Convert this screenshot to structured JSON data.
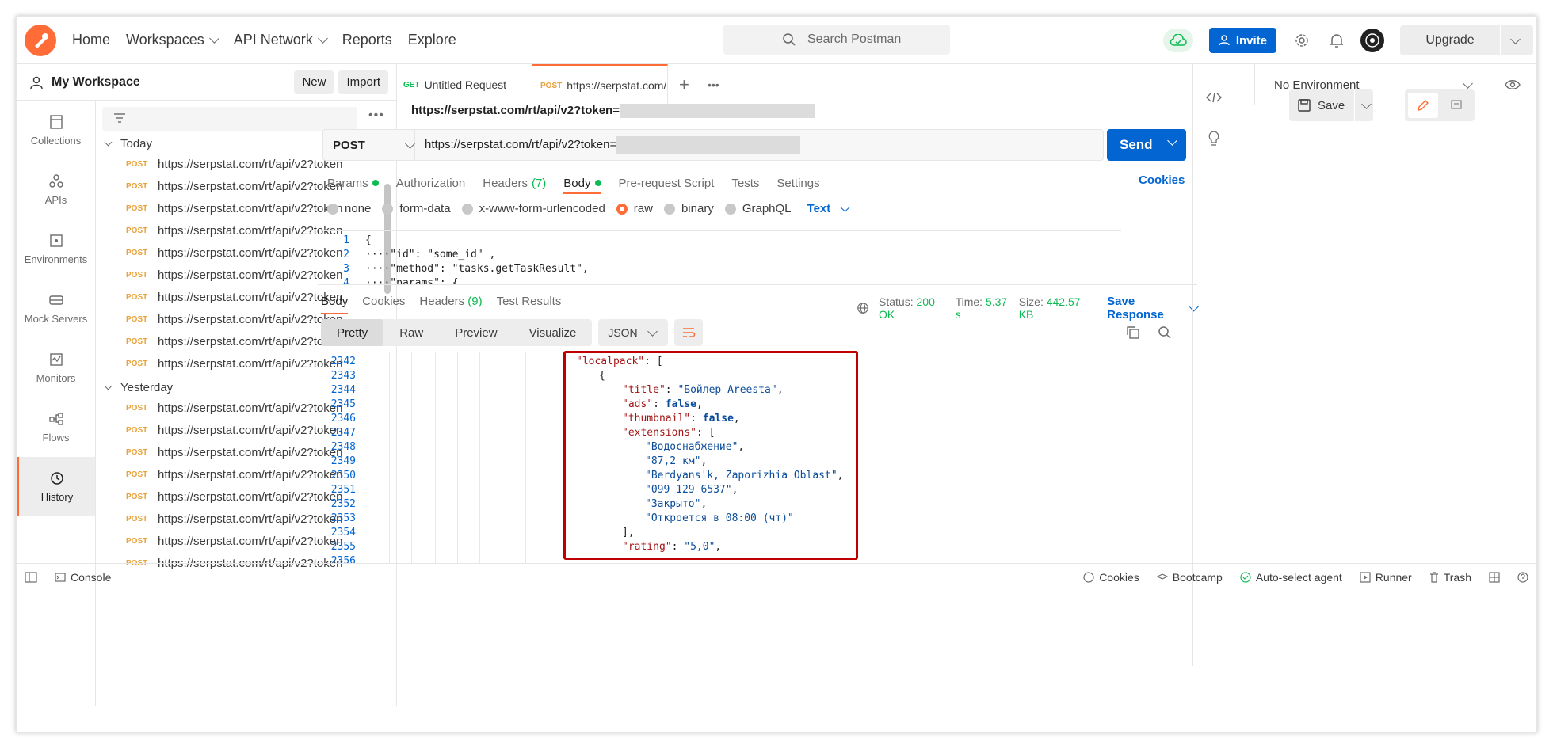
{
  "header": {
    "nav": [
      {
        "label": "Home"
      },
      {
        "label": "Workspaces",
        "dropdown": true
      },
      {
        "label": "API Network",
        "dropdown": true
      },
      {
        "label": "Reports"
      },
      {
        "label": "Explore"
      }
    ],
    "search_placeholder": "Search Postman",
    "invite_label": "Invite",
    "upgrade_label": "Upgrade",
    "accent": "#ff6c37",
    "primary": "#0265d2"
  },
  "workspace": {
    "title": "My Workspace",
    "new_label": "New",
    "import_label": "Import"
  },
  "rail": [
    {
      "label": "Collections",
      "icon": "collections-icon"
    },
    {
      "label": "APIs",
      "icon": "apis-icon"
    },
    {
      "label": "Environments",
      "icon": "environments-icon"
    },
    {
      "label": "Mock Servers",
      "icon": "mock-servers-icon"
    },
    {
      "label": "Monitors",
      "icon": "monitors-icon"
    },
    {
      "label": "Flows",
      "icon": "flows-icon"
    },
    {
      "label": "History",
      "icon": "history-icon",
      "active": true
    }
  ],
  "history": {
    "groups": [
      {
        "label": "Today",
        "items": [
          {
            "method": "POST",
            "url": "https://serpstat.com/rt/api/v2?token"
          },
          {
            "method": "POST",
            "url": "https://serpstat.com/rt/api/v2?token"
          },
          {
            "method": "POST",
            "url": "https://serpstat.com/rt/api/v2?token"
          },
          {
            "method": "POST",
            "url": "https://serpstat.com/rt/api/v2?token"
          },
          {
            "method": "POST",
            "url": "https://serpstat.com/rt/api/v2?token"
          },
          {
            "method": "POST",
            "url": "https://serpstat.com/rt/api/v2?token"
          },
          {
            "method": "POST",
            "url": "https://serpstat.com/rt/api/v2?token"
          },
          {
            "method": "POST",
            "url": "https://serpstat.com/rt/api/v2?token"
          },
          {
            "method": "POST",
            "url": "https://serpstat.com/rt/api/v2?token"
          },
          {
            "method": "POST",
            "url": "https://serpstat.com/rt/api/v2?token"
          }
        ]
      },
      {
        "label": "Yesterday",
        "items": [
          {
            "method": "POST",
            "url": "https://serpstat.com/rt/api/v2?token"
          },
          {
            "method": "POST",
            "url": "https://serpstat.com/rt/api/v2?token"
          },
          {
            "method": "POST",
            "url": "https://serpstat.com/rt/api/v2?token"
          },
          {
            "method": "POST",
            "url": "https://serpstat.com/rt/api/v2?token"
          },
          {
            "method": "POST",
            "url": "https://serpstat.com/rt/api/v2?token"
          },
          {
            "method": "POST",
            "url": "https://serpstat.com/rt/api/v2?token"
          },
          {
            "method": "POST",
            "url": "https://serpstat.com/rt/api/v2?token"
          },
          {
            "method": "POST",
            "url": "https://serpstat.com/rt/api/v2?token"
          }
        ]
      }
    ]
  },
  "tabs": [
    {
      "method": "GET",
      "label": "Untitled Request",
      "method_color": "#0cbb52"
    },
    {
      "method": "POST",
      "label": "https://serpstat.com/rt/a",
      "method_color": "#e8a23c",
      "active": true
    }
  ],
  "environment": "No Environment",
  "request": {
    "title": "https://serpstat.com/rt/api/v2?token=",
    "save_label": "Save",
    "method": "POST",
    "url": "https://serpstat.com/rt/api/v2?token=",
    "send_label": "Send",
    "tabs": [
      {
        "label": "Params",
        "dot": true
      },
      {
        "label": "Authorization"
      },
      {
        "label": "Headers",
        "count": "(7)"
      },
      {
        "label": "Body",
        "dot": true,
        "active": true
      },
      {
        "label": "Pre-request Script"
      },
      {
        "label": "Tests"
      },
      {
        "label": "Settings"
      }
    ],
    "cookies_label": "Cookies",
    "body_types": [
      {
        "label": "none"
      },
      {
        "label": "form-data"
      },
      {
        "label": "x-www-form-urlencoded"
      },
      {
        "label": "raw",
        "selected": true
      },
      {
        "label": "binary"
      },
      {
        "label": "GraphQL"
      }
    ],
    "body_format": "Text",
    "body_lines": [
      {
        "n": "1",
        "text": "{"
      },
      {
        "n": "2",
        "text": "····\"id\": \"some_id\" ,"
      },
      {
        "n": "3",
        "text": "····\"method\": \"tasks.getTaskResult\","
      },
      {
        "n": "4",
        "text": "····\"params\": {"
      }
    ]
  },
  "response": {
    "tabs": [
      {
        "label": "Body",
        "active": true
      },
      {
        "label": "Cookies"
      },
      {
        "label": "Headers",
        "count": "(9)"
      },
      {
        "label": "Test Results"
      }
    ],
    "status_label": "Status:",
    "status_value": "200 OK",
    "time_label": "Time:",
    "time_value": "5.37 s",
    "size_label": "Size:",
    "size_value": "442.57 KB",
    "save_label": "Save Response",
    "views": [
      "Pretty",
      "Raw",
      "Preview",
      "Visualize"
    ],
    "active_view": "Pretty",
    "format": "JSON",
    "lines": [
      {
        "n": "2342",
        "indent": 0,
        "key": "localpack",
        "rest": ": ["
      },
      {
        "n": "2343",
        "indent": 1,
        "rest": "{"
      },
      {
        "n": "2344",
        "indent": 2,
        "key": "title",
        "rest": ": ",
        "str": "Бойлер Areesta",
        "tail": ","
      },
      {
        "n": "2345",
        "indent": 2,
        "key": "ads",
        "rest": ": ",
        "kw": "false",
        "tail": ","
      },
      {
        "n": "2346",
        "indent": 2,
        "key": "thumbnail",
        "rest": ": ",
        "kw": "false",
        "tail": ","
      },
      {
        "n": "2347",
        "indent": 2,
        "key": "extensions",
        "rest": ": ["
      },
      {
        "n": "2348",
        "indent": 3,
        "str": "Водоснабжение",
        "tail": ","
      },
      {
        "n": "2349",
        "indent": 3,
        "str": "87,2 км",
        "tail": ","
      },
      {
        "n": "2350",
        "indent": 3,
        "str": "Berdyans'k, Zaporizhia Oblast",
        "tail": ","
      },
      {
        "n": "2351",
        "indent": 3,
        "str": "099 129 6537",
        "tail": ","
      },
      {
        "n": "2352",
        "indent": 3,
        "str": "Закрыто",
        "tail": ","
      },
      {
        "n": "2353",
        "indent": 3,
        "str": "Откроется в 08:00 (чт)",
        "tail": ""
      },
      {
        "n": "2354",
        "indent": 2,
        "rest": "],"
      },
      {
        "n": "2355",
        "indent": 2,
        "key": "rating",
        "rest": ": ",
        "str": "5,0",
        "tail": ","
      },
      {
        "n": "2356",
        "indent": 2,
        "rest": ""
      }
    ]
  },
  "statusbar": {
    "console": "Console",
    "cookies": "Cookies",
    "bootcamp": "Bootcamp",
    "agent": "Auto-select agent",
    "runner": "Runner",
    "trash": "Trash"
  }
}
